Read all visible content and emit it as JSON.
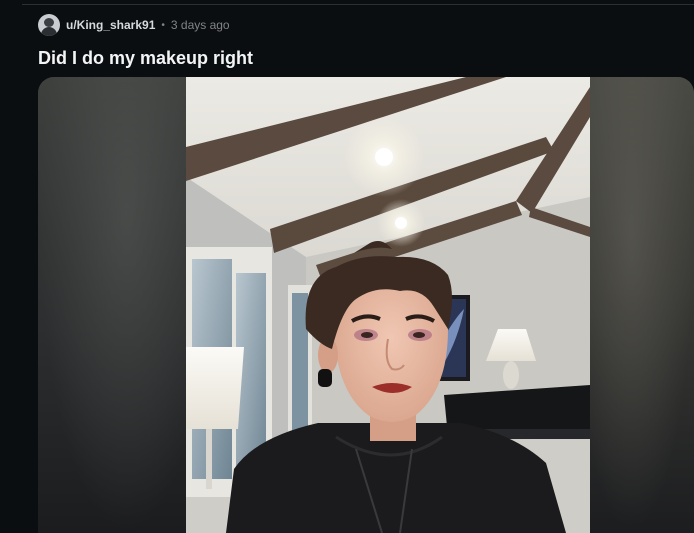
{
  "post": {
    "username": "u/King_shark91",
    "separator": "•",
    "timestamp": "3 days ago",
    "title": "Did I do my makeup right"
  },
  "icons": {
    "avatar": "user-avatar-icon"
  },
  "colors": {
    "background": "#0b0e11",
    "title": "#f2f4f5",
    "meta": "#818384"
  }
}
